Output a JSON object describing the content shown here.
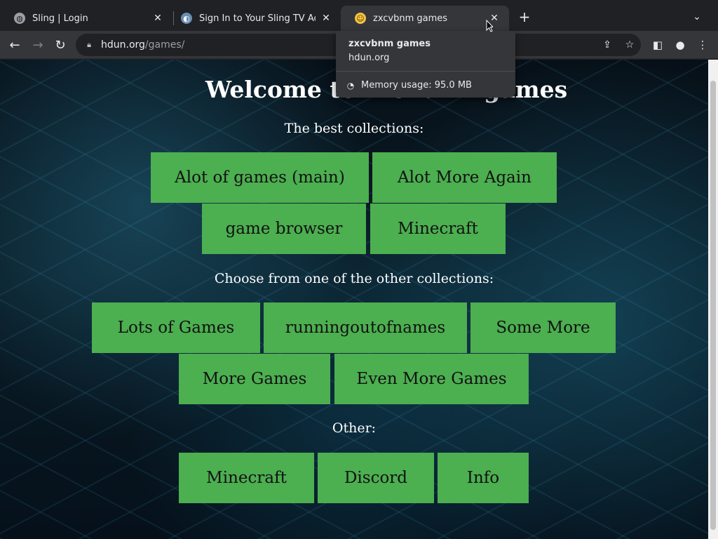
{
  "browser": {
    "tabs": [
      {
        "title": "Sling | Login",
        "favicon": "globe-icon"
      },
      {
        "title": "Sign In to Your Sling TV Account",
        "favicon": "sling-icon"
      },
      {
        "title": "zxcvbnm games",
        "favicon": "smiley-icon",
        "active": true
      }
    ],
    "address": {
      "domain": "hdun.org",
      "path": "/games/"
    },
    "hovercard": {
      "title": "zxcvbnm games",
      "domain": "hdun.org",
      "memory": "Memory usage: 95.0 MB"
    }
  },
  "page": {
    "heading": "Welcome to zxcvbnm games",
    "best_label": "The best collections:",
    "best_buttons": [
      "Alot of games (main)",
      "Alot More Again",
      "game browser",
      "Minecraft"
    ],
    "other_label": "Choose from one of the other collections:",
    "other_buttons": [
      "Lots of Games",
      "runningoutofnames",
      "Some More",
      "More Games",
      "Even More Games"
    ],
    "misc_label": "Other:",
    "misc_buttons": [
      "Minecraft",
      "Discord",
      "Info"
    ]
  },
  "colors": {
    "button_green": "#4caf50",
    "tabstrip": "#202124",
    "toolbar": "#35363a"
  }
}
